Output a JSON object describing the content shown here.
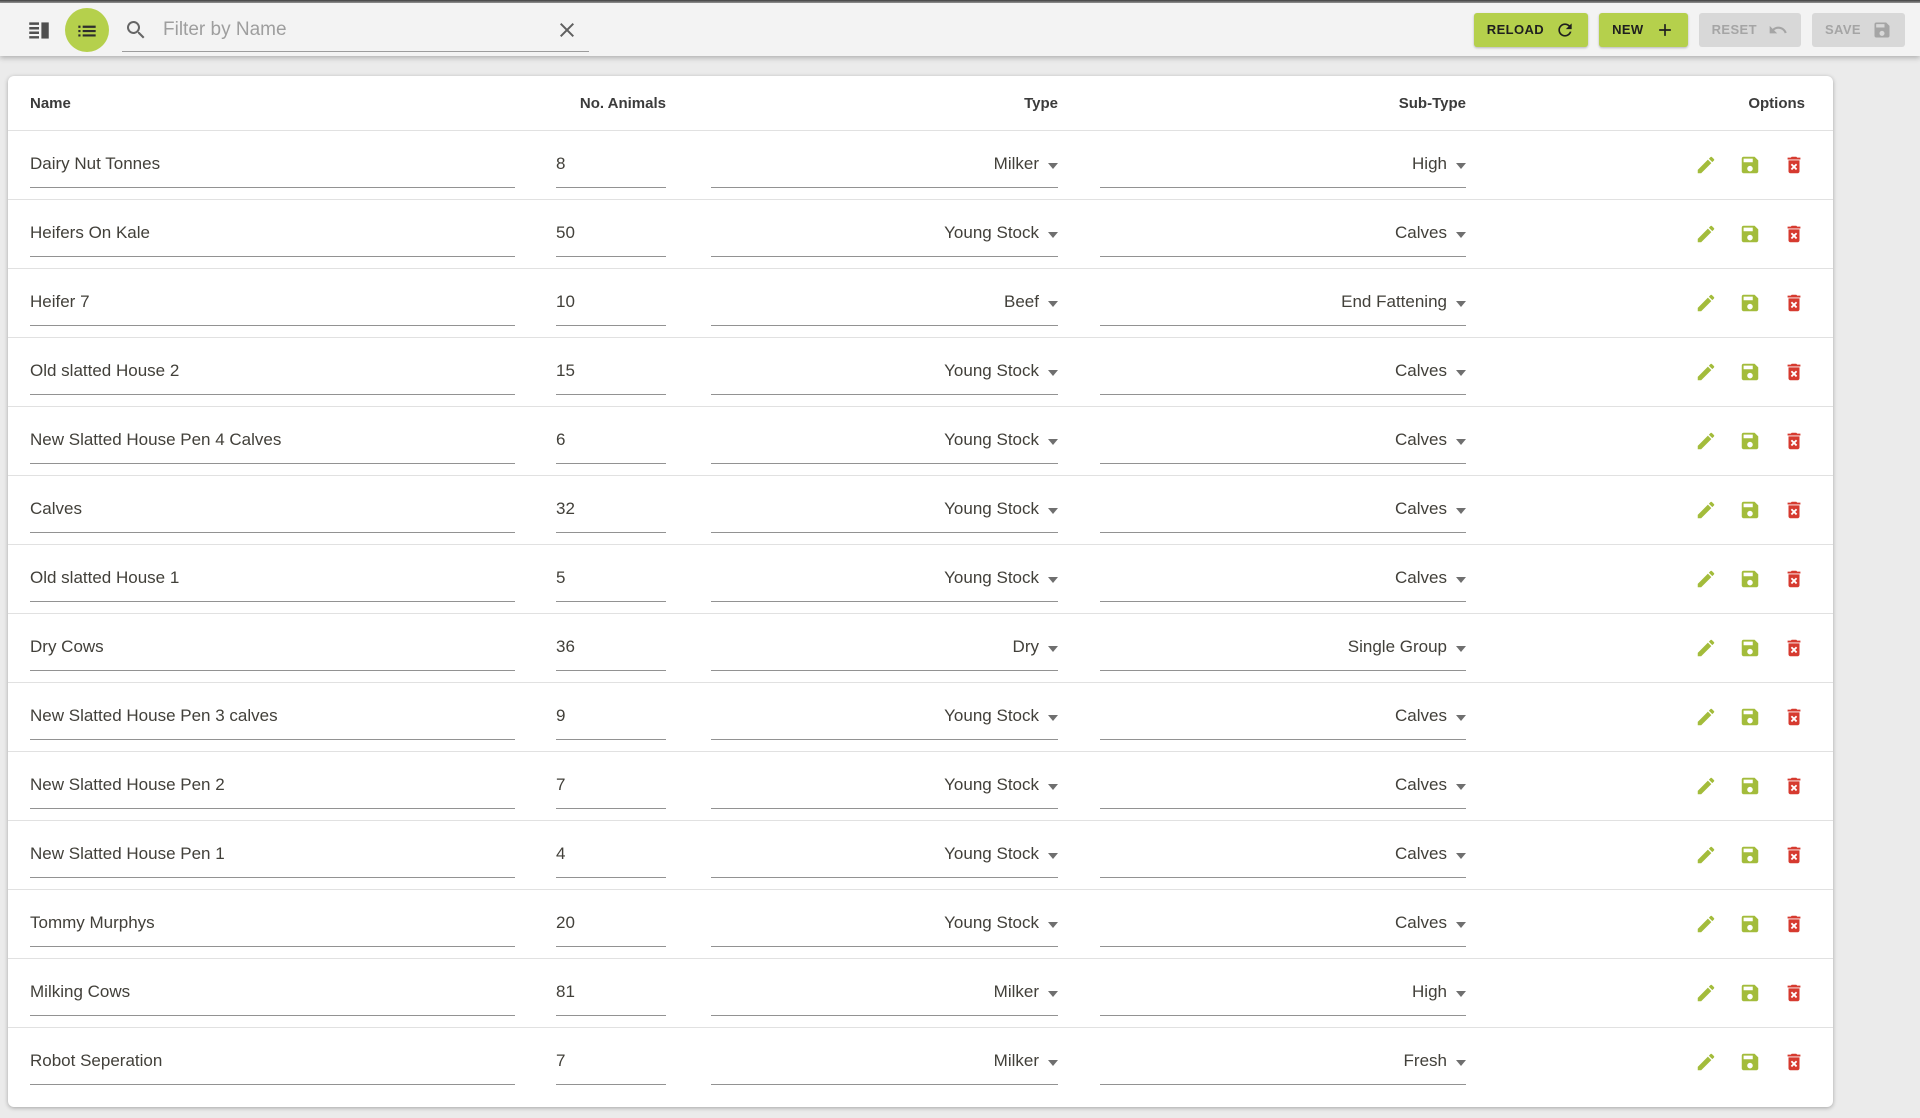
{
  "toolbar": {
    "view_toggle_icon": "vertical-split-icon",
    "list_button_icon": "list-icon",
    "search": {
      "icon": "search-icon",
      "placeholder": "Filter by Name",
      "value": "",
      "clear_icon": "close-icon"
    },
    "buttons": [
      {
        "label": "RELOAD",
        "icon": "refresh-icon",
        "enabled": true
      },
      {
        "label": "NEW",
        "icon": "plus-icon",
        "enabled": true
      },
      {
        "label": "RESET",
        "icon": "undo-icon",
        "enabled": false
      },
      {
        "label": "SAVE",
        "icon": "save-icon",
        "enabled": false
      }
    ]
  },
  "table": {
    "columns": [
      "Name",
      "No. Animals",
      "Type",
      "Sub-Type",
      "Options"
    ],
    "row_option_icons": [
      "edit-icon",
      "save-icon",
      "delete-icon"
    ],
    "rows": [
      {
        "name": "Dairy Nut Tonnes",
        "animals": "8",
        "type": "Milker",
        "subtype": "High"
      },
      {
        "name": "Heifers On Kale",
        "animals": "50",
        "type": "Young Stock",
        "subtype": "Calves"
      },
      {
        "name": "Heifer 7",
        "animals": "10",
        "type": "Beef",
        "subtype": "End Fattening"
      },
      {
        "name": "Old slatted House 2",
        "animals": "15",
        "type": "Young Stock",
        "subtype": "Calves"
      },
      {
        "name": "New Slatted House Pen 4 Calves",
        "animals": "6",
        "type": "Young Stock",
        "subtype": "Calves"
      },
      {
        "name": "Calves",
        "animals": "32",
        "type": "Young Stock",
        "subtype": "Calves"
      },
      {
        "name": "Old slatted House 1",
        "animals": "5",
        "type": "Young Stock",
        "subtype": "Calves"
      },
      {
        "name": "Dry Cows",
        "animals": "36",
        "type": "Dry",
        "subtype": "Single Group"
      },
      {
        "name": "New Slatted House Pen 3 calves",
        "animals": "9",
        "type": "Young Stock",
        "subtype": "Calves"
      },
      {
        "name": "New Slatted House Pen 2",
        "animals": "7",
        "type": "Young Stock",
        "subtype": "Calves"
      },
      {
        "name": "New Slatted House Pen 1",
        "animals": "4",
        "type": "Young Stock",
        "subtype": "Calves"
      },
      {
        "name": "Tommy Murphys",
        "animals": "20",
        "type": "Young Stock",
        "subtype": "Calves"
      },
      {
        "name": "Milking Cows",
        "animals": "81",
        "type": "Milker",
        "subtype": "High"
      },
      {
        "name": "Robot Seperation",
        "animals": "7",
        "type": "Milker",
        "subtype": "Fresh"
      }
    ]
  },
  "colors": {
    "accent_green": "#b5d04c",
    "icon_green": "#a3bc3b",
    "delete_red": "#d63a2f",
    "disabled_bg": "#d8d8d8",
    "disabled_text": "#a5a5a5"
  }
}
